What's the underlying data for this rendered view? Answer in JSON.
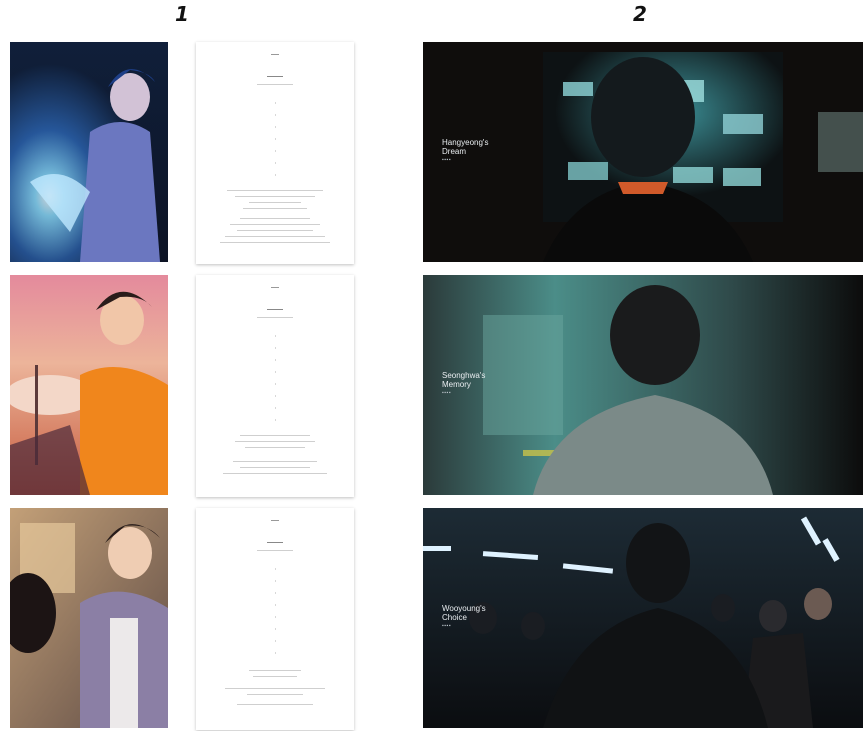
{
  "sections": [
    {
      "number": "1"
    },
    {
      "number": "2"
    }
  ],
  "stills": [
    {
      "caption_line1": "Hangyeong's",
      "caption_line2": "Dream"
    },
    {
      "caption_line1": "Seonghwa's",
      "caption_line2": "Memory"
    },
    {
      "caption_line1": "Wooyoung's",
      "caption_line2": "Choice"
    }
  ],
  "colors": {
    "illus1_bg": "#1a2740",
    "illus2_bg": "#e9a46d",
    "illus3_bg": "#8c6a52",
    "still_bg": "#121212"
  }
}
